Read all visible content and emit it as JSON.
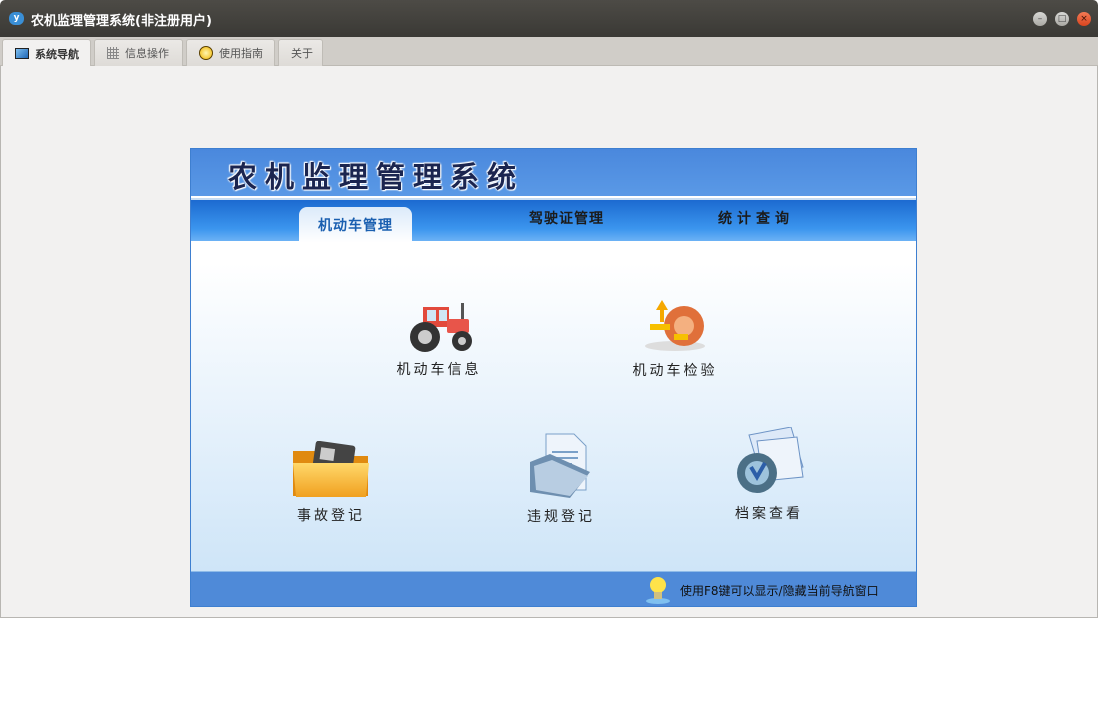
{
  "window": {
    "title": "农机监理管理系统(非注册用户)",
    "logo_text": "y",
    "controls": [
      "minimize",
      "maximize",
      "close"
    ]
  },
  "tabs": [
    {
      "label": "系统导航",
      "active": true
    },
    {
      "label": "信息操作"
    },
    {
      "label": "使用指南"
    },
    {
      "label": "关于"
    }
  ],
  "panel": {
    "title": "农机监理管理系统",
    "nav": [
      {
        "label": "机动车管理",
        "active": true
      },
      {
        "label": "驾驶证管理"
      },
      {
        "label": "统计查询"
      }
    ],
    "items": [
      {
        "label": "机动车信息"
      },
      {
        "label": "机动车检验"
      },
      {
        "label": "事故登记"
      },
      {
        "label": "违规登记"
      },
      {
        "label": "档案查看"
      }
    ],
    "footer_tip": "使用F8键可以显示/隐藏当前导航窗口"
  }
}
